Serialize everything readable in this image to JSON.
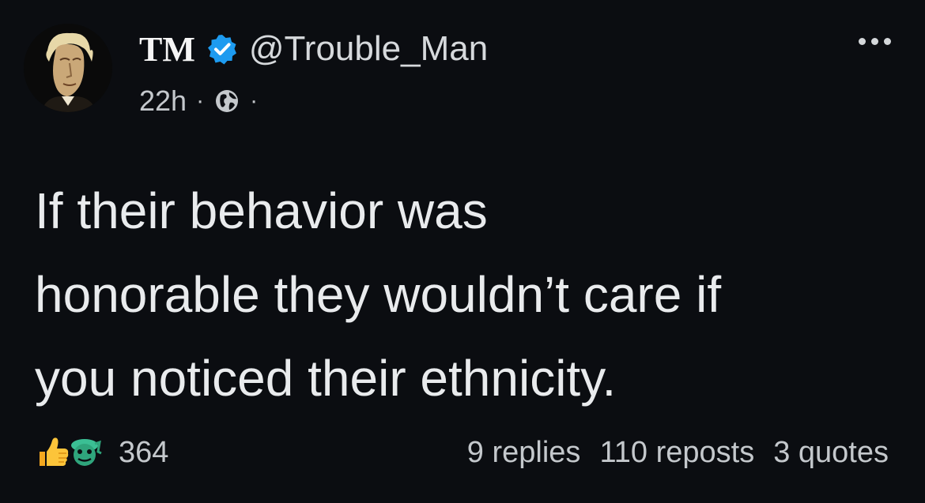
{
  "author": {
    "display_name": "TM",
    "handle": "@Trouble_Man",
    "verified": true,
    "verified_icon": "verified-badge-icon",
    "avatar": "portrait-avatar"
  },
  "meta": {
    "time": "22h",
    "separator": "·",
    "visibility_icon": "globe-icon"
  },
  "post": {
    "lines": [
      "If their behavior was",
      "honorable they wouldn’t care if",
      "you noticed their ethnicity."
    ]
  },
  "reactions": {
    "icons": [
      "thumbs-up-icon",
      "green-face-emoji-icon"
    ],
    "count": "364"
  },
  "stats": {
    "replies": "9 replies",
    "reposts": "110 reposts",
    "quotes": "3 quotes"
  },
  "colors": {
    "background": "#0b0d11",
    "text": "#e7e9ea",
    "muted": "#c4c8cc",
    "verified_blue": "#1d9bf0"
  }
}
